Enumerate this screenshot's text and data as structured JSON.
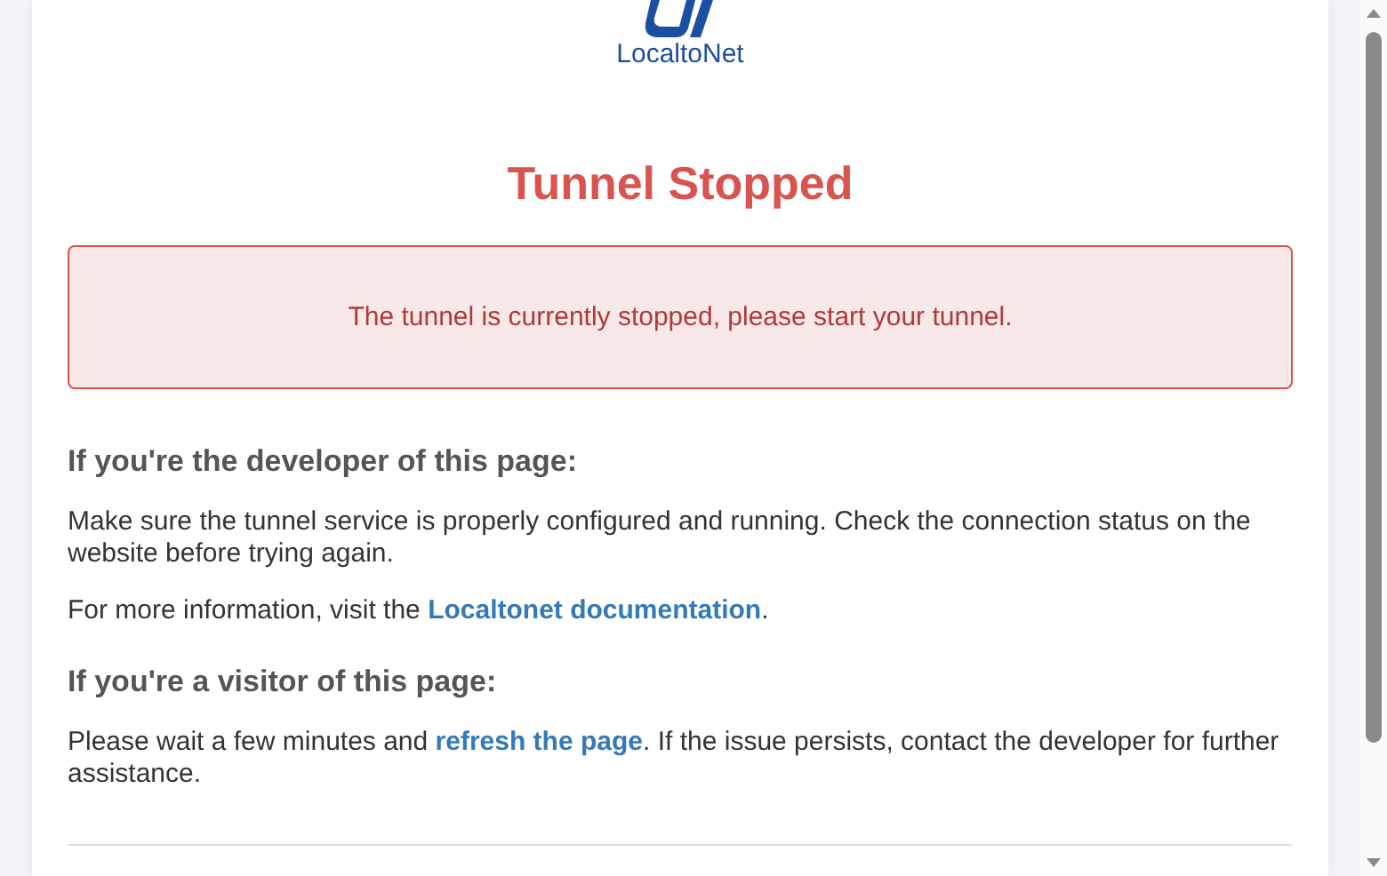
{
  "logo": {
    "text": "LocaltoNet"
  },
  "title": "Tunnel Stopped",
  "alert": "The tunnel is currently stopped, please start your tunnel.",
  "sections": [
    {
      "heading": "If you're the developer of this page:",
      "paragraphs": [
        [
          {
            "text": "Make sure the tunnel service is properly configured and running. Check the connection status on the website before trying again."
          }
        ],
        [
          {
            "text": "For more information, visit the "
          },
          {
            "text": "Localtonet documentation",
            "link": true
          },
          {
            "text": "."
          }
        ]
      ]
    },
    {
      "heading": "If you're a visitor of this page:",
      "paragraphs": [
        [
          {
            "text": "Please wait a few minutes and "
          },
          {
            "text": "refresh the page",
            "link": true
          },
          {
            "text": ". If the issue persists, contact the developer for further assistance."
          }
        ]
      ]
    }
  ]
}
